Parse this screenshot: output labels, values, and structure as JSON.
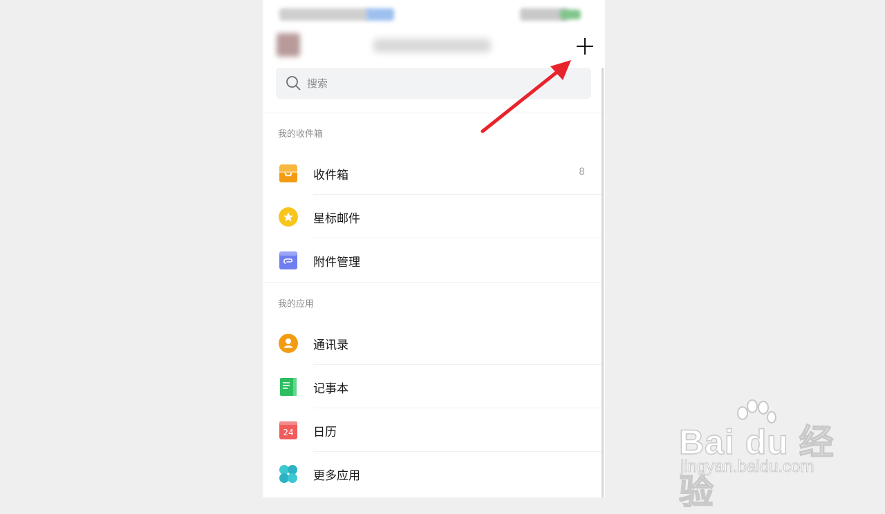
{
  "header": {
    "add_button": "+"
  },
  "search": {
    "placeholder": "搜索"
  },
  "sections": {
    "inbox_section": "我的收件箱",
    "apps_section": "我的应用"
  },
  "inbox_items": [
    {
      "label": "收件箱",
      "count": "8",
      "icon": "inbox-icon"
    },
    {
      "label": "星标邮件",
      "icon": "star-icon"
    },
    {
      "label": "附件管理",
      "icon": "attachment-icon"
    }
  ],
  "app_items": [
    {
      "label": "通讯录",
      "icon": "contacts-icon"
    },
    {
      "label": "记事本",
      "icon": "notepad-icon"
    },
    {
      "label": "日历",
      "icon": "calendar-icon",
      "badge": "24"
    },
    {
      "label": "更多应用",
      "icon": "more-apps-icon"
    }
  ],
  "colors": {
    "inbox": "#f5a623",
    "star": "#f8c51c",
    "attachment": "#6f7ff0",
    "contacts": "#f39c12",
    "notepad": "#2dbe60",
    "calendar": "#f05b5b",
    "more_apps": "#3cc8d0",
    "arrow": "#e8232b"
  },
  "watermark": {
    "brand": "Bai du 经验",
    "url": "jingyan.baidu.com"
  }
}
